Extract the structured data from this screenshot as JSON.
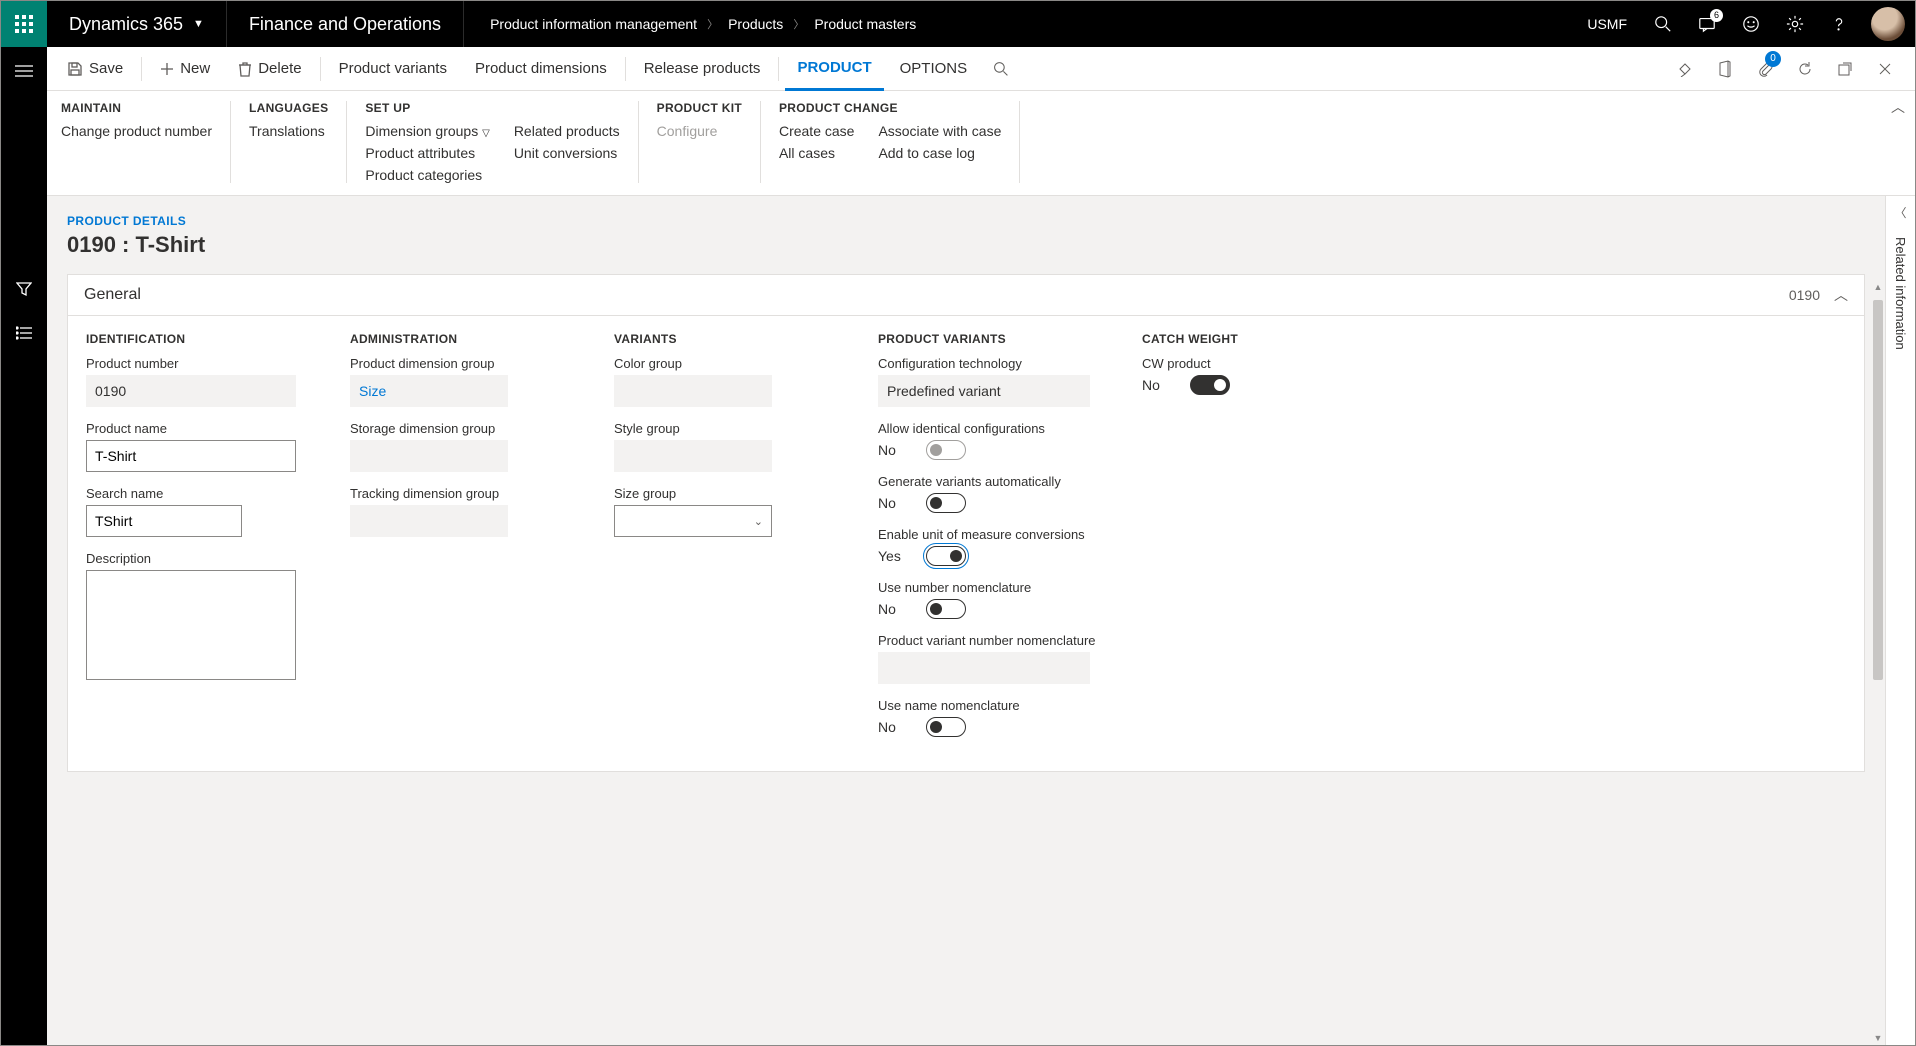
{
  "top": {
    "app": "Dynamics 365",
    "module": "Finance and Operations",
    "company": "USMF",
    "breadcrumb": [
      "Product information management",
      "Products",
      "Product masters"
    ],
    "message_count": "6"
  },
  "actionbar": {
    "save": "Save",
    "new": "New",
    "delete": "Delete",
    "variants": "Product variants",
    "dimensions": "Product dimensions",
    "release": "Release products",
    "product": "PRODUCT",
    "options": "OPTIONS",
    "attach_count": "0"
  },
  "ribbon": {
    "maintain": {
      "title": "MAINTAIN",
      "change_number": "Change product number"
    },
    "languages": {
      "title": "LANGUAGES",
      "translations": "Translations"
    },
    "setup": {
      "title": "SET UP",
      "dim_groups": "Dimension groups",
      "attributes": "Product attributes",
      "categories": "Product categories",
      "related": "Related products",
      "unit_conv": "Unit conversions"
    },
    "kit": {
      "title": "PRODUCT KIT",
      "configure": "Configure"
    },
    "change": {
      "title": "PRODUCT CHANGE",
      "create_case": "Create case",
      "all_cases": "All cases",
      "associate": "Associate with case",
      "add_log": "Add to case log"
    }
  },
  "page": {
    "section": "PRODUCT DETAILS",
    "title": "0190 : T-Shirt"
  },
  "general": {
    "title": "General",
    "code": "0190",
    "identification": {
      "title": "IDENTIFICATION",
      "product_number_lbl": "Product number",
      "product_number": "0190",
      "product_name_lbl": "Product name",
      "product_name": "T-Shirt",
      "search_name_lbl": "Search name",
      "search_name": "TShirt",
      "description_lbl": "Description",
      "description": ""
    },
    "admin": {
      "title": "ADMINISTRATION",
      "pdg_lbl": "Product dimension group",
      "pdg": "Size",
      "sdg_lbl": "Storage dimension group",
      "sdg": "",
      "tdg_lbl": "Tracking dimension group",
      "tdg": ""
    },
    "variants": {
      "title": "VARIANTS",
      "color_lbl": "Color group",
      "color": "",
      "style_lbl": "Style group",
      "style": "",
      "size_lbl": "Size group",
      "size": ""
    },
    "product_variants": {
      "title": "PRODUCT VARIANTS",
      "config_tech_lbl": "Configuration technology",
      "config_tech": "Predefined variant",
      "allow_ident_lbl": "Allow identical configurations",
      "allow_ident": "No",
      "gen_auto_lbl": "Generate variants automatically",
      "gen_auto": "No",
      "uom_conv_lbl": "Enable unit of measure conversions",
      "uom_conv": "Yes",
      "use_num_nom_lbl": "Use number nomenclature",
      "use_num_nom": "No",
      "pvnn_lbl": "Product variant number nomenclature",
      "pvnn": "",
      "use_name_nom_lbl": "Use name nomenclature",
      "use_name_nom": "No"
    },
    "catch_weight": {
      "title": "CATCH WEIGHT",
      "cw_lbl": "CW product",
      "cw": "No"
    }
  },
  "side": {
    "label": "Related information"
  }
}
